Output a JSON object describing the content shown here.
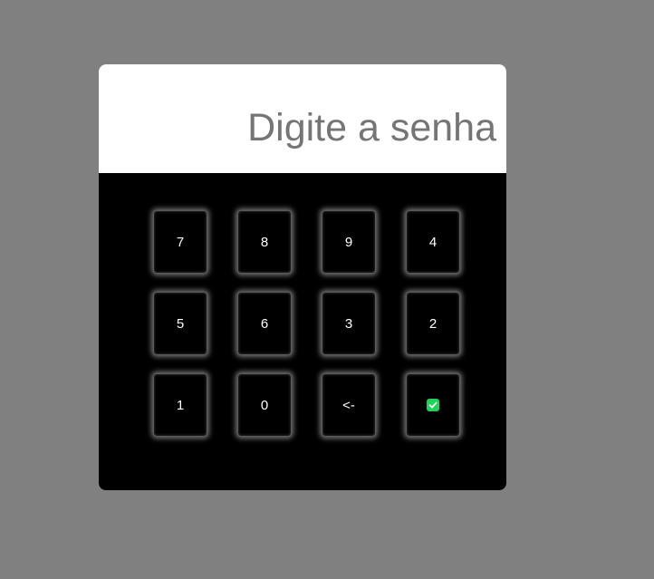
{
  "display": {
    "value": "",
    "placeholder": "Digite a senha"
  },
  "keypad": {
    "rows": [
      [
        "7",
        "8",
        "9",
        "4"
      ],
      [
        "5",
        "6",
        "3",
        "2"
      ],
      [
        "1",
        "0",
        "<-"
      ]
    ],
    "confirm_icon": "check-box-icon",
    "confirm_color": "#1fd35a"
  },
  "colors": {
    "background": "#808080",
    "panel": "#000000",
    "display_bg": "#ffffff",
    "placeholder_text": "#757575"
  }
}
